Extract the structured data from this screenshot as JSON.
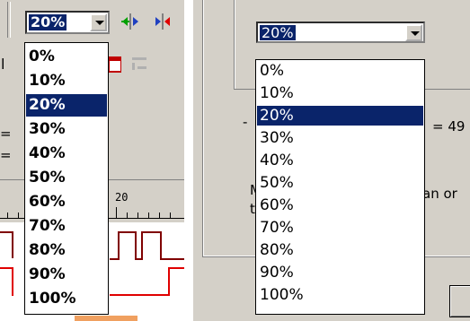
{
  "left": {
    "combo": {
      "value": "20%"
    },
    "list": {
      "items": [
        "0%",
        "10%",
        "20%",
        "30%",
        "40%",
        "50%",
        "60%",
        "70%",
        "80%",
        "90%",
        "100%"
      ],
      "selected_index": 2
    },
    "ruler": {
      "label": "20"
    },
    "behind": {
      "eq1": "=",
      "eq2": "=",
      "char_l": "l"
    }
  },
  "right": {
    "combo": {
      "value": "20%"
    },
    "list": {
      "items": [
        "0%",
        "10%",
        "20%",
        "30%",
        "40%",
        "50%",
        "60%",
        "70%",
        "80%",
        "90%",
        "100%"
      ],
      "selected_index": 2
    },
    "behind": {
      "eq_text": "= 49",
      "an_text": "an or",
      "dash": "-",
      "m_char": "M",
      "t_char": "t"
    }
  },
  "colors": {
    "selection": "#0a246a",
    "face": "#d4d0c8",
    "signal_red": "#e00000"
  }
}
